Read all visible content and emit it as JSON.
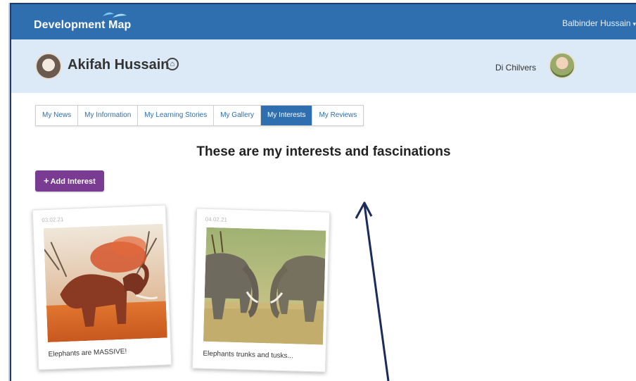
{
  "navbar": {
    "brand": "Development Map",
    "user": "Balbinder Hussain",
    "caret": "▾"
  },
  "profile": {
    "child_name": "Akifah Hussain",
    "teacher_name": "Di Chilvers"
  },
  "tabs": [
    {
      "label": "My News",
      "active": false
    },
    {
      "label": "My Information",
      "active": false
    },
    {
      "label": "My Learning Stories",
      "active": false
    },
    {
      "label": "My Gallery",
      "active": false
    },
    {
      "label": "My Interests",
      "active": true
    },
    {
      "label": "My Reviews",
      "active": false
    }
  ],
  "main": {
    "heading": "These are my interests and fascinations",
    "add_button": {
      "icon": "+",
      "label": "Add Interest"
    }
  },
  "cards": [
    {
      "date": "03.02.21",
      "caption": "Elephants are MASSIVE!"
    },
    {
      "date": "04.02.21",
      "caption": "Elephants trunks and tusks..."
    }
  ],
  "colors": {
    "navbar": "#2f6fb0",
    "profile_bar": "#dce9f6",
    "active_tab": "#2f6fb0",
    "add_button": "#7a3b93",
    "annotation_arrow": "#1b2b5a"
  }
}
